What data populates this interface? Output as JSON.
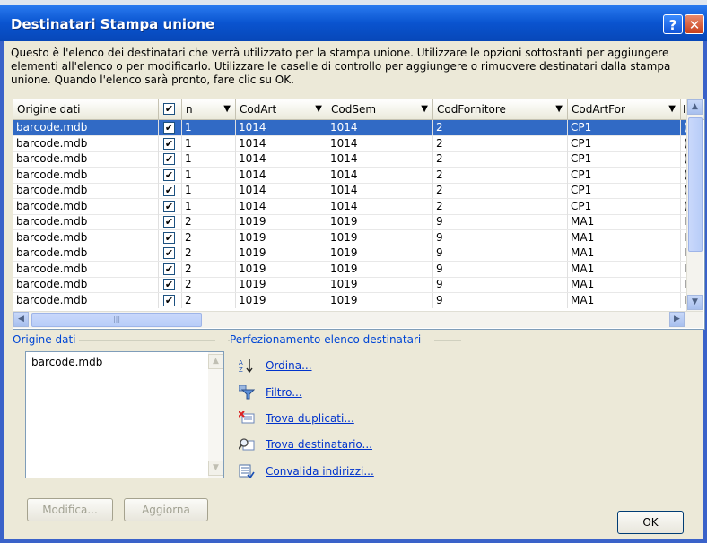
{
  "window": {
    "title": "Destinatari Stampa unione",
    "help_glyph": "?",
    "close_glyph": "✕"
  },
  "description": "Questo è l'elenco dei destinatari che verrà utilizzato per la stampa unione. Utilizzare le opzioni sottostanti per aggiungere elementi all'elenco o per modificarlo. Utilizzare le caselle di controllo per aggiungere o rimuovere destinatari dalla stampa unione. Quando l'elenco sarà pronto, fare clic su OK.",
  "grid": {
    "columns": [
      "Origine dati",
      "",
      "n",
      "CodArt",
      "CodSem",
      "CodFornitore",
      "CodArtFor",
      "I"
    ],
    "check_glyph": "✔",
    "rows": [
      [
        "barcode.mdb",
        "1",
        "1014",
        "1014",
        "2",
        "CP1",
        "("
      ],
      [
        "barcode.mdb",
        "1",
        "1014",
        "1014",
        "2",
        "CP1",
        "("
      ],
      [
        "barcode.mdb",
        "1",
        "1014",
        "1014",
        "2",
        "CP1",
        "("
      ],
      [
        "barcode.mdb",
        "1",
        "1014",
        "1014",
        "2",
        "CP1",
        "("
      ],
      [
        "barcode.mdb",
        "1",
        "1014",
        "1014",
        "2",
        "CP1",
        "("
      ],
      [
        "barcode.mdb",
        "1",
        "1014",
        "1014",
        "2",
        "CP1",
        "("
      ],
      [
        "barcode.mdb",
        "2",
        "1019",
        "1019",
        "9",
        "MA1",
        "I"
      ],
      [
        "barcode.mdb",
        "2",
        "1019",
        "1019",
        "9",
        "MA1",
        "I"
      ],
      [
        "barcode.mdb",
        "2",
        "1019",
        "1019",
        "9",
        "MA1",
        "I"
      ],
      [
        "barcode.mdb",
        "2",
        "1019",
        "1019",
        "9",
        "MA1",
        "I"
      ],
      [
        "barcode.mdb",
        "2",
        "1019",
        "1019",
        "9",
        "MA1",
        "I"
      ],
      [
        "barcode.mdb",
        "2",
        "1019",
        "1019",
        "9",
        "MA1",
        "I"
      ]
    ],
    "selected_row": 0
  },
  "source_group": {
    "label": "Origine dati",
    "items": [
      "barcode.mdb"
    ],
    "modify_button": "Modifica...",
    "refresh_button": "Aggiorna"
  },
  "refine_group": {
    "label": "Perfezionamento elenco destinatari",
    "actions": [
      {
        "label": "Ordina...",
        "icon": "sort-az-icon"
      },
      {
        "label": "Filtro...",
        "icon": "filter-icon"
      },
      {
        "label": "Trova duplicati...",
        "icon": "find-duplicates-icon"
      },
      {
        "label": "Trova destinatario...",
        "icon": "find-recipient-icon"
      },
      {
        "label": "Convalida indirizzi...",
        "icon": "validate-addresses-icon"
      }
    ]
  },
  "ok_button": "OK"
}
